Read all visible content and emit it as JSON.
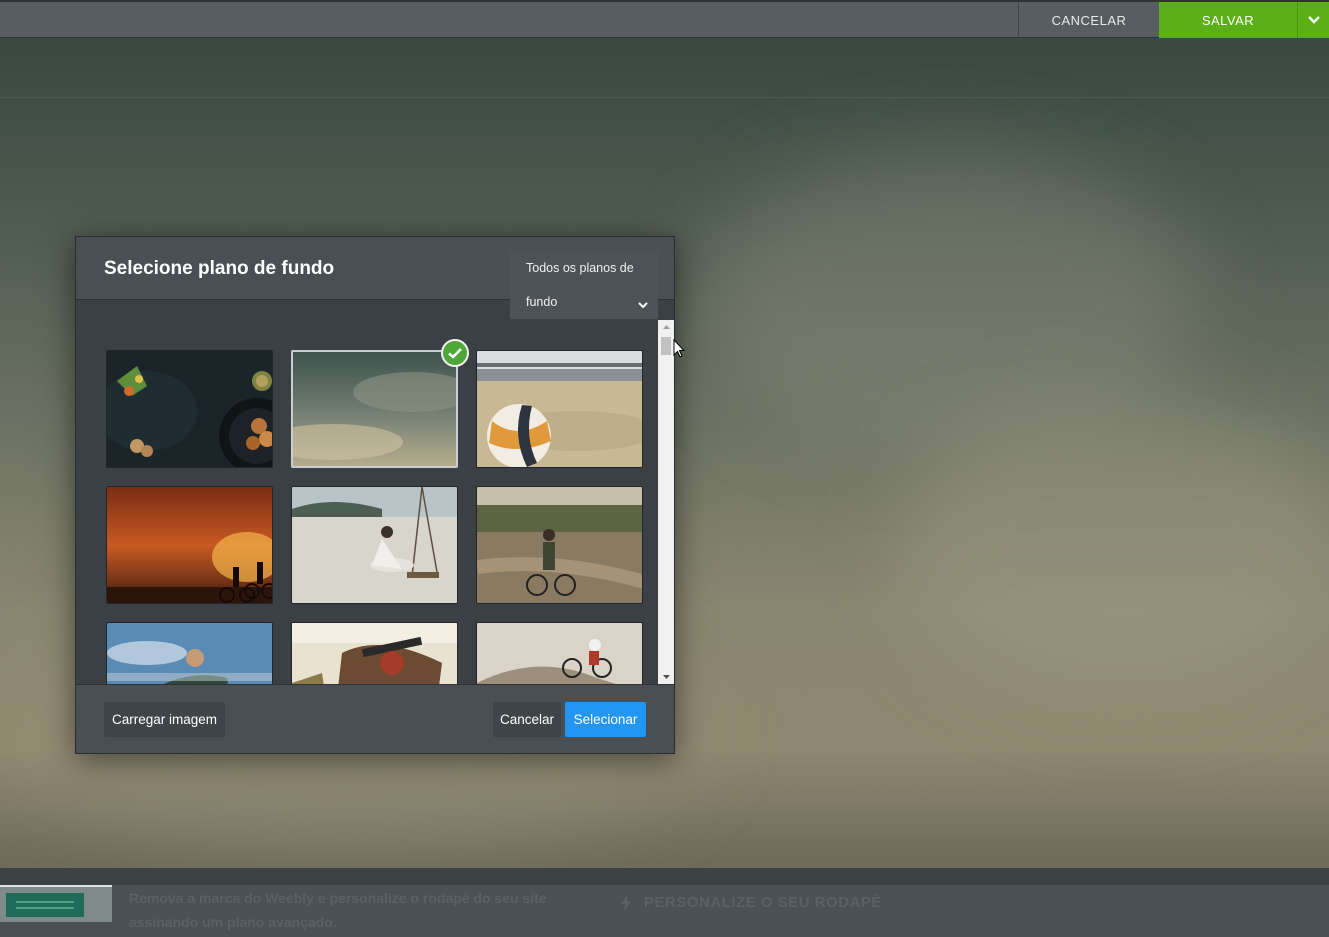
{
  "toolbar": {
    "cancel_label": "CANCELAR",
    "save_label": "SALVAR",
    "save_menu_icon": "chevron-down-icon"
  },
  "modal": {
    "title": "Selecione plano de fundo",
    "filter": {
      "selected_line1": "Todos os planos de",
      "selected_line2": "fundo",
      "icon": "chevron-down-icon"
    },
    "thumbnails": [
      {
        "name": "food-dark-table",
        "selected": false
      },
      {
        "name": "cloudy-sky",
        "selected": true
      },
      {
        "name": "volleyball-beach-pier",
        "selected": false
      },
      {
        "name": "sunset-cyclists",
        "selected": false
      },
      {
        "name": "beach-swing",
        "selected": false
      },
      {
        "name": "cyclist-dirt-road",
        "selected": false
      },
      {
        "name": "man-blue-sky",
        "selected": false
      },
      {
        "name": "mountain-biker-closeup",
        "selected": false
      },
      {
        "name": "bmx-rider-rocks",
        "selected": false
      }
    ],
    "upload_label": "Carregar imagem",
    "cancel_label": "Cancelar",
    "select_label": "Selecionar"
  },
  "footer": {
    "promo_text": "Remova a marca do Weebly e personalize o rodapé do seu site assinando um plano avançado.",
    "cta_label": "PERSONALIZE O SEU RODAPÉ",
    "cta_icon": "lightning-icon"
  },
  "colors": {
    "save_green": "#5cb017",
    "select_blue": "#2196f3",
    "check_green": "#4fa73a"
  }
}
